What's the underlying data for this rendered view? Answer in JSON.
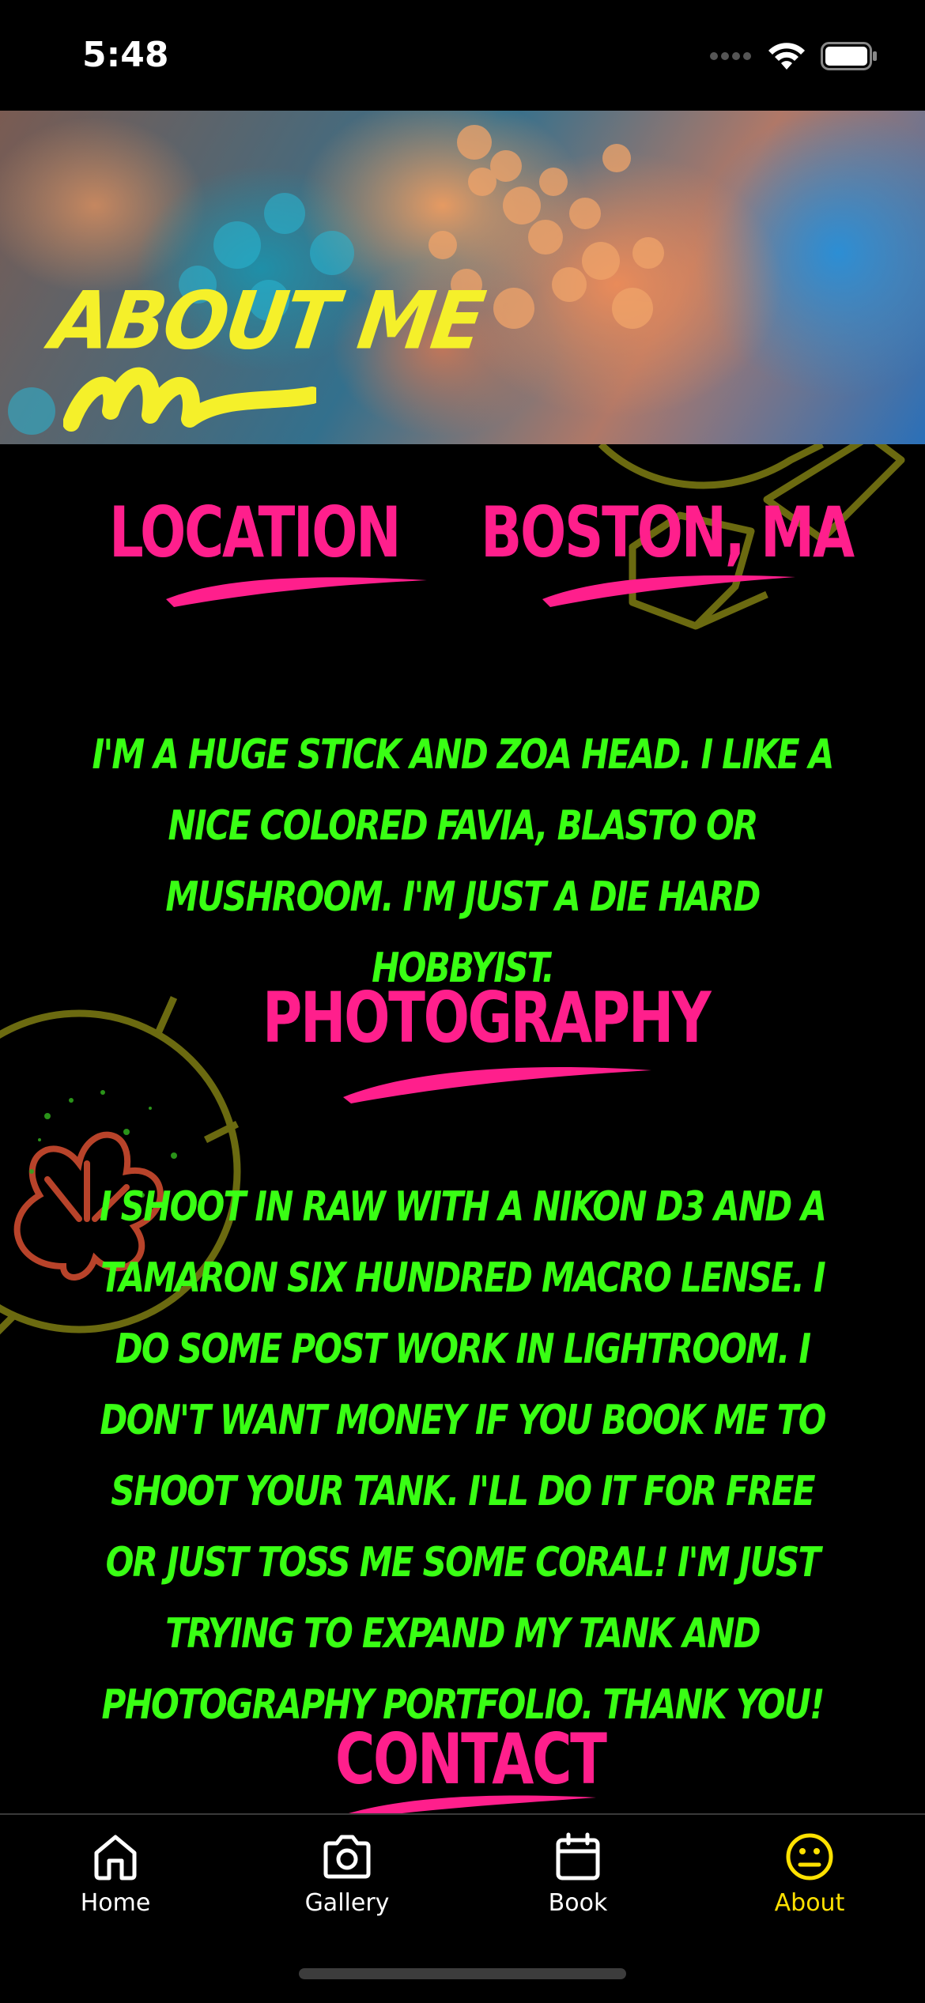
{
  "status_bar": {
    "time": "5:48"
  },
  "header": {
    "title": "ABOUT ME"
  },
  "location": {
    "label": "LOCATION",
    "value": "BOSTON, MA"
  },
  "intro_text": "I'm a huge stick and zoa head. I like a nice colored favia, blasto or mushroom. I'm just a die hard hobbyist.",
  "photography": {
    "heading": "PHOTOGRAPHY",
    "text": "I shoot in raw with a Nikon D3 and a Tamaron six hundred macro lense. I do some post work in Lightroom. I don't want money if you book me to shoot your tank. I'll do it for free or just toss me some coral! I'm just trying to expand my tank and photography portfolio. Thank you!"
  },
  "contact": {
    "heading": "CONTACT"
  },
  "tab_bar": {
    "tabs": [
      {
        "label": "Home",
        "icon": "home-icon"
      },
      {
        "label": "Gallery",
        "icon": "camera-icon"
      },
      {
        "label": "Book",
        "icon": "calendar-icon"
      },
      {
        "label": "About",
        "icon": "face-icon",
        "active": true
      }
    ]
  },
  "colors": {
    "accent_pink": "#ff1f8c",
    "text_green": "#39ff14",
    "header_yellow": "#f5f02a",
    "active_tab": "#ffe100"
  }
}
